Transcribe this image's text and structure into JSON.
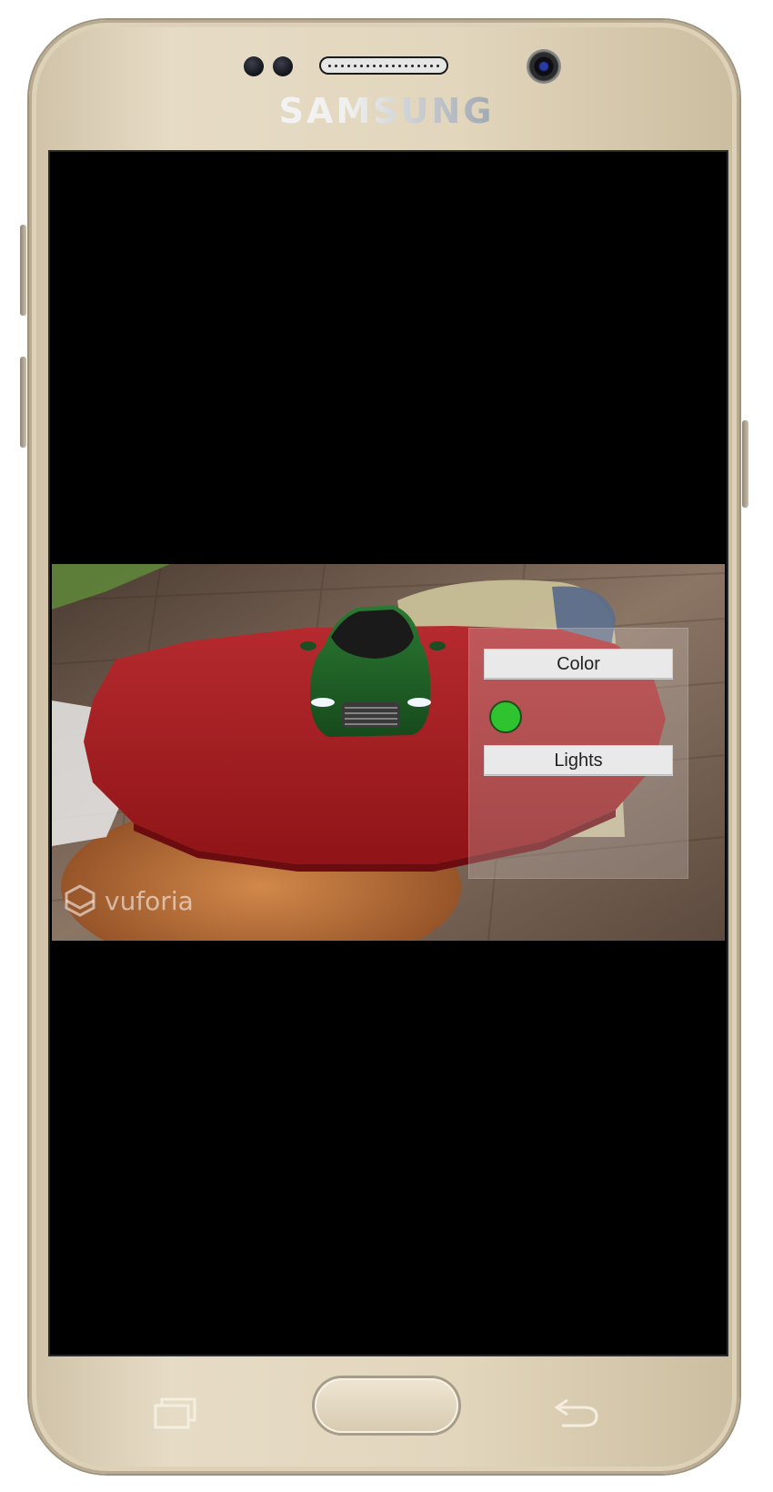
{
  "device": {
    "brand": "SAMSUNG"
  },
  "ar_view": {
    "watermark": "vuforia",
    "panel": {
      "color_button_label": "Color",
      "lights_button_label": "Lights",
      "selected_color": "#2fc42f"
    }
  },
  "colors": {
    "table": "#a0191d",
    "car": "#1f5a26",
    "screen_background": "#000000"
  },
  "icons": {
    "recent_apps": "recent-apps-icon",
    "back": "back-icon"
  }
}
